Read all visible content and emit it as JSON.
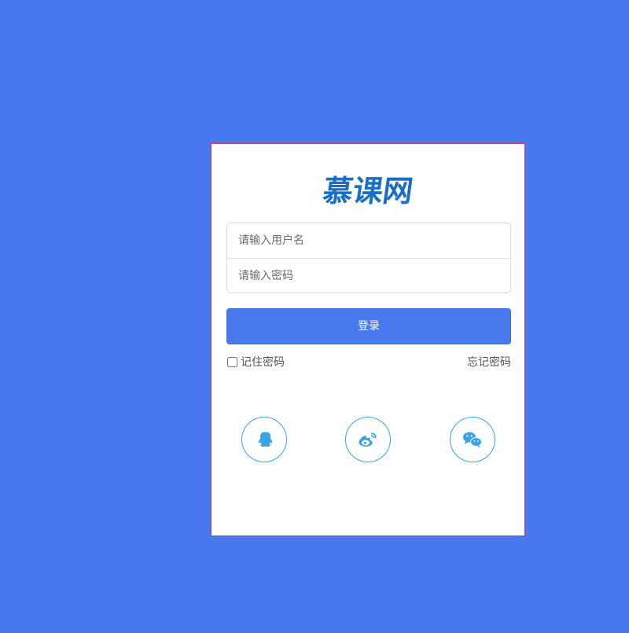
{
  "brand": {
    "logo_text": "慕课网"
  },
  "form": {
    "username_placeholder": "请输入用户名",
    "password_placeholder": "请输入密码",
    "login_label": "登录",
    "remember_label": "记住密码",
    "forgot_label": "忘记密码"
  },
  "social": [
    {
      "name": "qq-icon"
    },
    {
      "name": "weibo-icon"
    },
    {
      "name": "wechat-icon"
    }
  ],
  "colors": {
    "background": "#4978ee",
    "accent": "#4a79ee",
    "logo": "#1b6fc3",
    "social": "#3aa3e3",
    "card_border": "#d6384d"
  }
}
